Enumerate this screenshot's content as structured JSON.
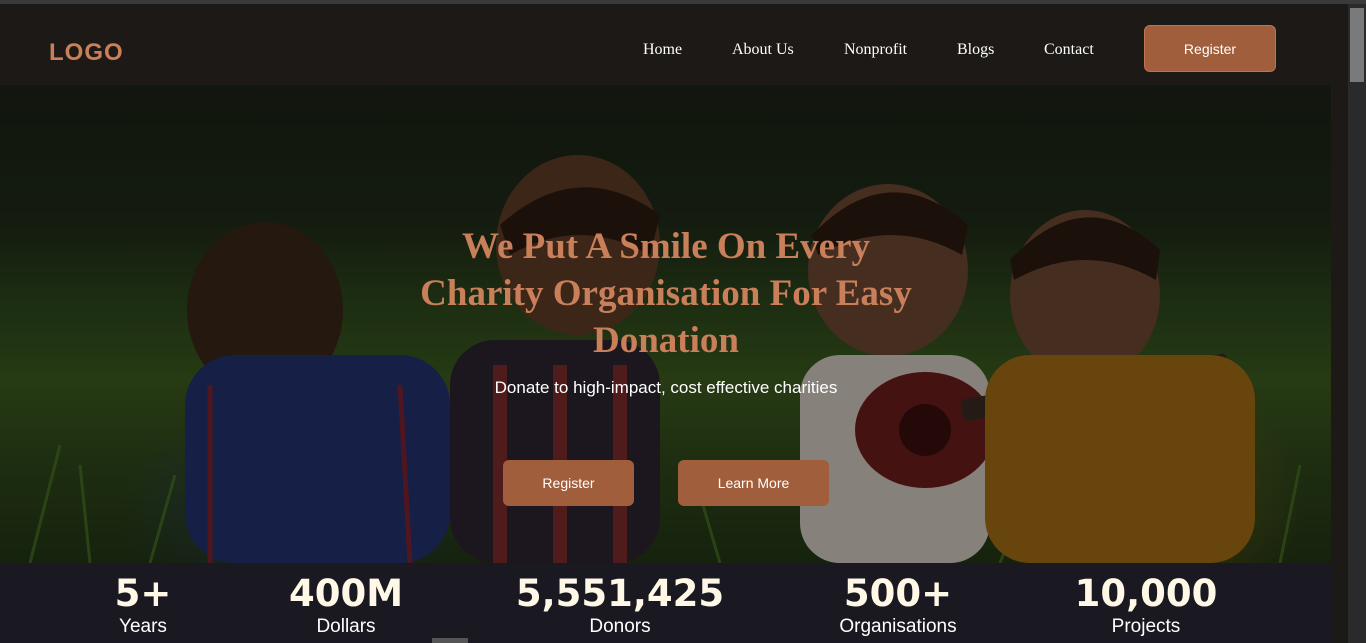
{
  "header": {
    "logo": "LOGO",
    "nav": [
      "Home",
      "About Us",
      "Nonprofit",
      "Blogs",
      "Contact"
    ],
    "register_label": "Register"
  },
  "hero": {
    "title": "We Put A Smile On Every Charity Organisation For Easy Donation",
    "subtitle": "Donate to high-impact, cost effective charities",
    "register_label": "Register",
    "learn_more_label": "Learn More"
  },
  "stats": [
    {
      "value": "5+",
      "label": "Years"
    },
    {
      "value": "400M",
      "label": "Dollars"
    },
    {
      "value": "5,551,425",
      "label": "Donors"
    },
    {
      "value": "500+",
      "label": "Organisations"
    },
    {
      "value": "10,000",
      "label": "Projects"
    }
  ],
  "colors": {
    "accent": "#a15e3c",
    "logo": "#c9805a",
    "header_bg": "#1c1916",
    "stats_bg": "#1a1820"
  }
}
